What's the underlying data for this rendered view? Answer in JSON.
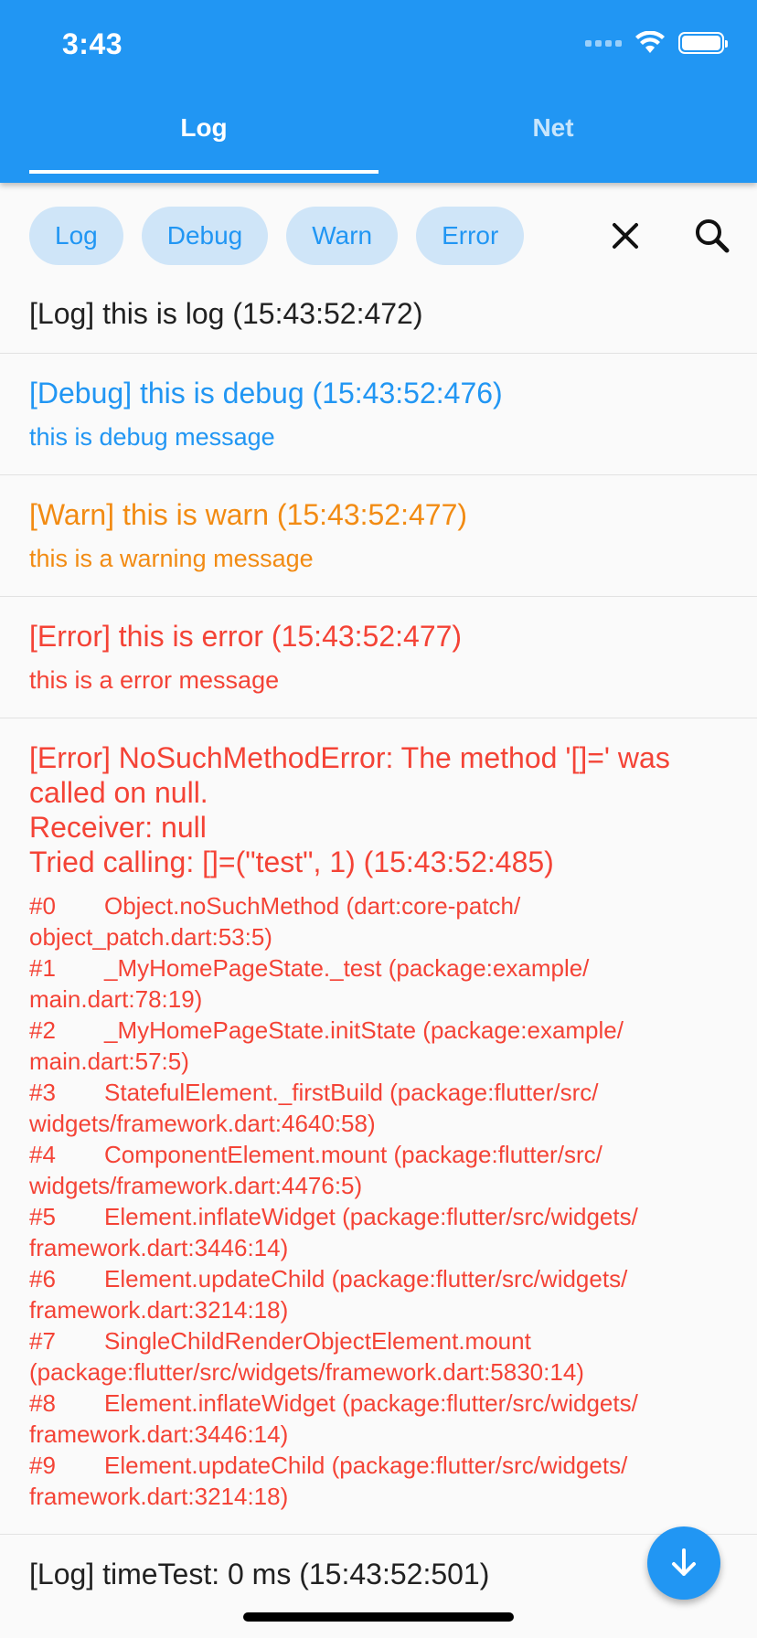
{
  "status_bar": {
    "time": "3:43"
  },
  "tabs": [
    {
      "label": "Log",
      "active": true
    },
    {
      "label": "Net",
      "active": false
    }
  ],
  "filters": [
    {
      "label": "Log"
    },
    {
      "label": "Debug"
    },
    {
      "label": "Warn"
    },
    {
      "label": "Error"
    }
  ],
  "colors": {
    "primary": "#2196f3",
    "chip_bg": "#cfe5f8",
    "log": "#212121",
    "debug": "#2196f3",
    "warn": "#f28b13",
    "error": "#f44336"
  },
  "icons": {
    "clear": "close-icon",
    "search": "search-icon",
    "scroll_down": "arrow-down-icon"
  },
  "logs": [
    {
      "level": "log",
      "title": "[Log] this is log (15:43:52:472)"
    },
    {
      "level": "debug",
      "title": "[Debug] this is debug (15:43:52:476)",
      "message": "this is debug message"
    },
    {
      "level": "warn",
      "title": "[Warn] this is warn (15:43:52:477)",
      "message": "this is a warning message"
    },
    {
      "level": "error",
      "title": "[Error] this is error (15:43:52:477)",
      "message": "this is a error message"
    },
    {
      "level": "error",
      "title_lines": [
        "[Error] NoSuchMethodError: The method '[]=' was",
        "called on null.",
        "Receiver: null",
        "Tried calling: []=(\"test\", 1) (15:43:52:485)"
      ],
      "trace": [
        {
          "idx": "#0",
          "line1": "Object.noSuchMethod (dart:core-patch/",
          "line2": "object_patch.dart:53:5)"
        },
        {
          "idx": "#1",
          "line1": "_MyHomePageState._test (package:example/",
          "line2": "main.dart:78:19)"
        },
        {
          "idx": "#2",
          "line1": "_MyHomePageState.initState (package:example/",
          "line2": "main.dart:57:5)"
        },
        {
          "idx": "#3",
          "line1": "StatefulElement._firstBuild (package:flutter/src/",
          "line2": "widgets/framework.dart:4640:58)"
        },
        {
          "idx": "#4",
          "line1": "ComponentElement.mount (package:flutter/src/",
          "line2": "widgets/framework.dart:4476:5)"
        },
        {
          "idx": "#5",
          "line1": "Element.inflateWidget (package:flutter/src/widgets/",
          "line2": "framework.dart:3446:14)"
        },
        {
          "idx": "#6",
          "line1": "Element.updateChild (package:flutter/src/widgets/",
          "line2": "framework.dart:3214:18)"
        },
        {
          "idx": "#7",
          "line1": "SingleChildRenderObjectElement.mount",
          "line2": "(package:flutter/src/widgets/framework.dart:5830:14)"
        },
        {
          "idx": "#8",
          "line1": "Element.inflateWidget (package:flutter/src/widgets/",
          "line2": "framework.dart:3446:14)"
        },
        {
          "idx": "#9",
          "line1": "Element.updateChild (package:flutter/src/widgets/",
          "line2": "framework.dart:3214:18)"
        }
      ]
    },
    {
      "level": "log",
      "title": "[Log] timeTest: 0 ms (15:43:52:501)"
    }
  ]
}
